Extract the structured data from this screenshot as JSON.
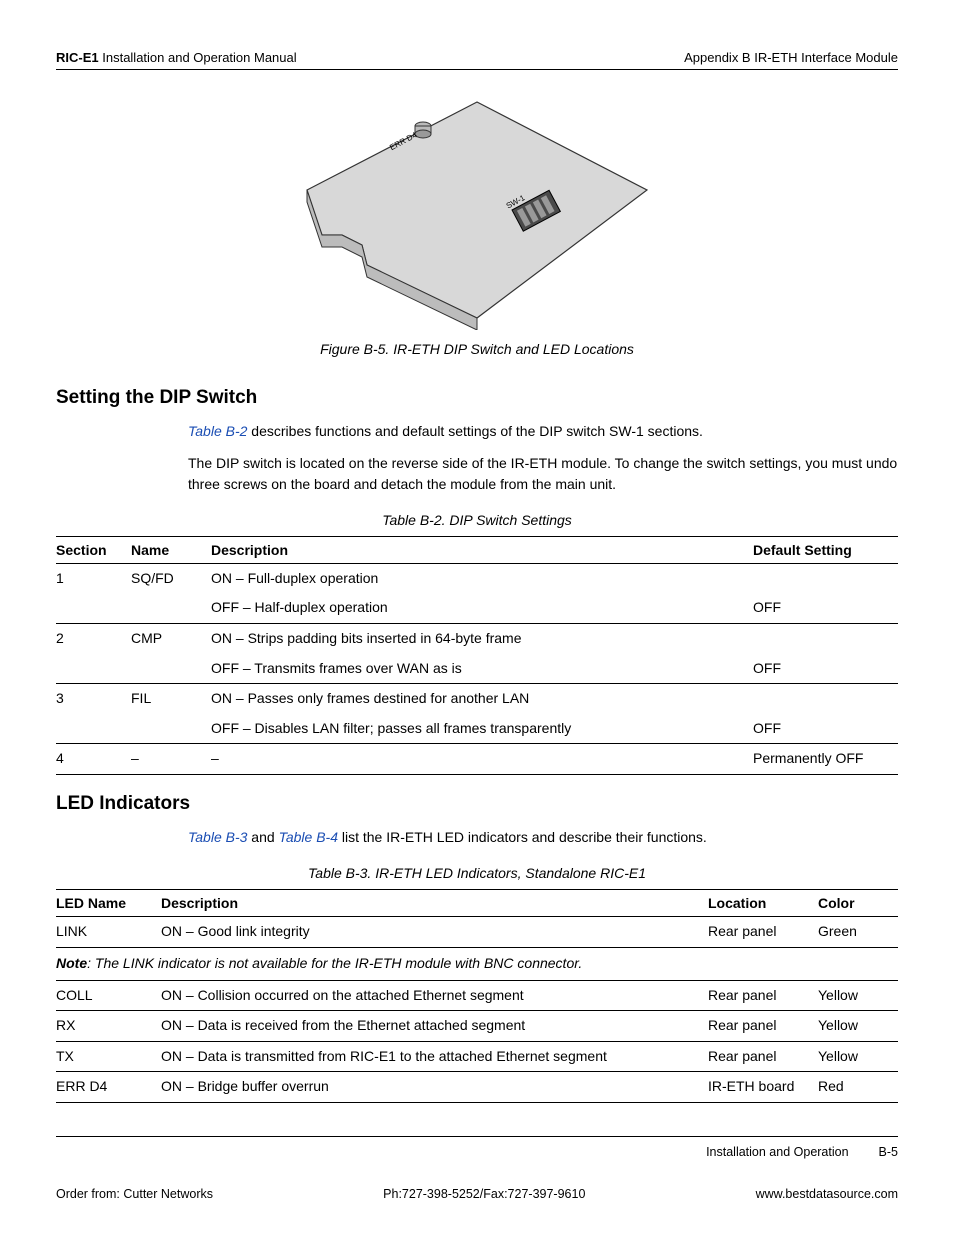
{
  "header": {
    "left_bold": "RIC-E1",
    "left_rest": " Installation and Operation Manual",
    "right": "Appendix B  IR-ETH Interface Module"
  },
  "figure": {
    "label_err": "ERR D4",
    "label_sw": "SW-1",
    "caption": "Figure B-5.  IR-ETH DIP Switch and LED Locations"
  },
  "sectionA": {
    "title": "Setting the DIP Switch",
    "p1_xref": "Table B-2",
    "p1_rest": " describes functions and default settings of the DIP switch SW-1 sections.",
    "p2": "The DIP switch is located on the reverse side of the IR-ETH module. To change the switch settings, you must undo three screws on the board and detach the module from the main unit."
  },
  "tableB2": {
    "caption": "Table B-2.  DIP Switch Settings",
    "headers": [
      "Section",
      "Name",
      "Description",
      "Default Setting"
    ],
    "rows": [
      {
        "section": "1",
        "name": "SQ/FD",
        "desc": "ON – Full-duplex operation",
        "def": ""
      },
      {
        "section": "",
        "name": "",
        "desc": "OFF – Half-duplex operation",
        "def": "OFF"
      },
      {
        "section": "2",
        "name": "CMP",
        "desc": "ON – Strips padding bits inserted in 64-byte frame",
        "def": ""
      },
      {
        "section": "",
        "name": "",
        "desc": "OFF – Transmits frames over WAN as is",
        "def": "OFF"
      },
      {
        "section": "3",
        "name": "FIL",
        "desc": "ON – Passes only frames destined for another LAN",
        "def": ""
      },
      {
        "section": "",
        "name": "",
        "desc": "OFF – Disables LAN filter; passes all frames transparently",
        "def": "OFF"
      },
      {
        "section": "4",
        "name": "–",
        "desc": "–",
        "def": "Permanently OFF"
      }
    ]
  },
  "sectionB": {
    "title": "LED Indicators",
    "p1_xref1": "Table B-3",
    "p1_mid": " and ",
    "p1_xref2": "Table B-4",
    "p1_rest": " list the IR-ETH LED indicators and describe their functions."
  },
  "tableB3": {
    "caption": "Table B-3.  IR-ETH LED Indicators, Standalone RIC-E1",
    "headers": [
      "LED Name",
      "Description",
      "Location",
      "Color"
    ],
    "note_label": "Note",
    "note_text": ": The LINK indicator is not available for the IR-ETH module with BNC connector.",
    "rows_top": [
      {
        "name": "LINK",
        "desc": "ON – Good link integrity",
        "loc": "Rear panel",
        "color": "Green"
      }
    ],
    "rows_bottom": [
      {
        "name": "COLL",
        "desc": "ON – Collision occurred on the attached Ethernet segment",
        "loc": "Rear panel",
        "color": "Yellow"
      },
      {
        "name": "RX",
        "desc": "ON – Data is received from the Ethernet attached segment",
        "loc": "Rear panel",
        "color": "Yellow"
      },
      {
        "name": "TX",
        "desc": "ON – Data is transmitted from RIC-E1 to the attached Ethernet segment",
        "loc": "Rear panel",
        "color": "Yellow"
      },
      {
        "name": "ERR D4",
        "desc": "ON – Bridge buffer overrun",
        "loc": "IR-ETH board",
        "color": "Red"
      }
    ]
  },
  "footer": {
    "section": "Installation and Operation",
    "page": "B-5",
    "order": "Order from: Cutter Networks",
    "phone": "Ph:727-398-5252/Fax:727-397-9610",
    "url": "www.bestdatasource.com"
  }
}
